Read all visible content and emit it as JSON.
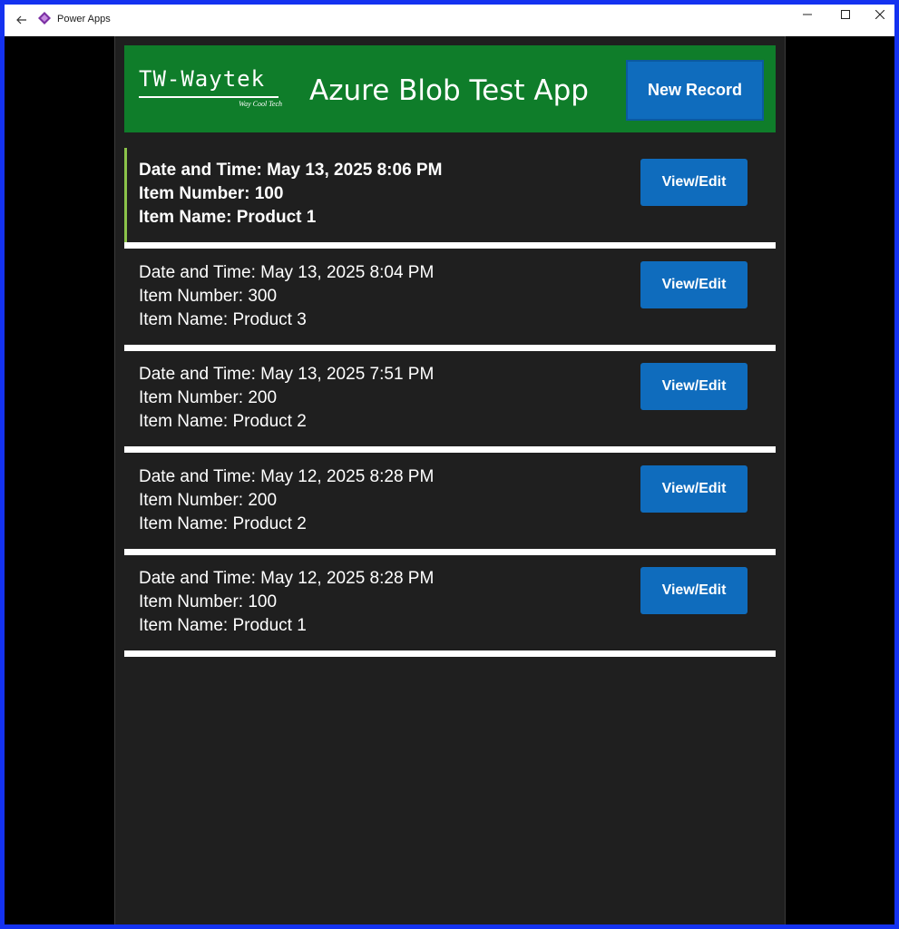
{
  "window": {
    "title": "Power Apps",
    "controls": {
      "minimize": "─",
      "maximize": "☐",
      "close": "✕"
    }
  },
  "header": {
    "logo_text": "TW-Waytek",
    "logo_tagline": "Way Cool Tech",
    "app_name": "Azure Blob Test App",
    "new_record_label": "New Record",
    "background_color": "#0f7d2a"
  },
  "gallery": {
    "button_label": "View/Edit",
    "records": [
      {
        "datetime": "Date and Time: May 13, 2025 8:06 PM",
        "item_number": "Item Number: 100",
        "item_name": "Item Name: Product 1",
        "selected": true
      },
      {
        "datetime": "Date and Time: May 13, 2025 8:04 PM",
        "item_number": "Item Number: 300",
        "item_name": "Item Name: Product 3",
        "selected": false
      },
      {
        "datetime": "Date and Time: May 13, 2025 7:51 PM",
        "item_number": "Item Number: 200",
        "item_name": "Item Name: Product 2",
        "selected": false
      },
      {
        "datetime": "Date and Time: May 12, 2025 8:28 PM",
        "item_number": "Item Number: 200",
        "item_name": "Item Name: Product 2",
        "selected": false
      },
      {
        "datetime": "Date and Time: May 12, 2025 8:28 PM",
        "item_number": "Item Number: 100",
        "item_name": "Item Name: Product 1",
        "selected": false
      }
    ]
  },
  "colors": {
    "accent_button": "#0f6cbd",
    "selection_bar": "#8bc34a",
    "canvas_background": "#1f1f1f"
  }
}
